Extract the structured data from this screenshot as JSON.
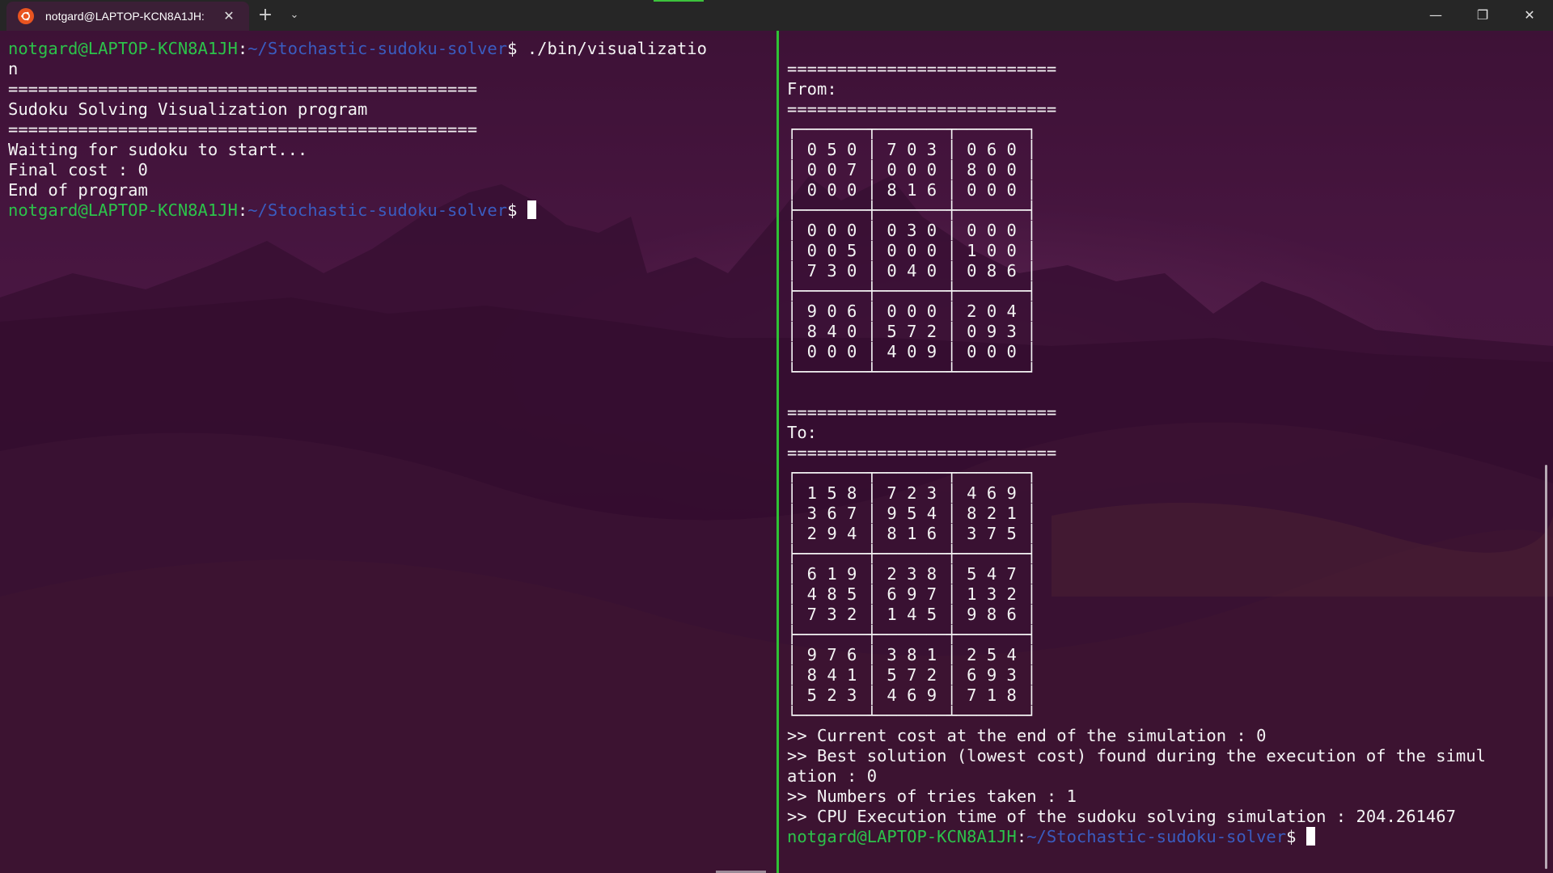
{
  "titlebar": {
    "tab_title": "notgard@LAPTOP-KCN8A1JH:",
    "tab_close_icon": "close-icon",
    "new_tab_glyph": "+",
    "dropdown_glyph": "⌄",
    "minimize_glyph": "—",
    "restore_glyph": "❐",
    "close_glyph": "✕"
  },
  "prompt": {
    "user": "notgard@LAPTOP-KCN8A1JH",
    "colon": ":",
    "path": "~/Stochastic-sudoku-solver",
    "dollar": "$ "
  },
  "left_pane": {
    "command_line1": "./bin/visualizatio",
    "command_line2": "n",
    "lines": [
      "===============================================",
      "Sudoku Solving Visualization program",
      "===============================================",
      "Waiting for sudoku to start...",
      "Final cost : 0",
      "End of program"
    ]
  },
  "right_pane": {
    "from_lines": [
      "===========================",
      "From:",
      "===========================",
      "┌───────┬───────┬───────┐",
      "│ 0 5 0 │ 7 0 3 │ 0 6 0 │",
      "│ 0 0 7 │ 0 0 0 │ 8 0 0 │",
      "│ 0 0 0 │ 8 1 6 │ 0 0 0 │",
      "├───────┼───────┼───────┤",
      "│ 0 0 0 │ 0 3 0 │ 0 0 0 │",
      "│ 0 0 5 │ 0 0 0 │ 1 0 0 │",
      "│ 7 3 0 │ 0 4 0 │ 0 8 6 │",
      "├───────┼───────┼───────┤",
      "│ 9 0 6 │ 0 0 0 │ 2 0 4 │",
      "│ 8 4 0 │ 5 7 2 │ 0 9 3 │",
      "│ 0 0 0 │ 4 0 9 │ 0 0 0 │",
      "└───────┴───────┴───────┘",
      ""
    ],
    "to_lines": [
      "===========================",
      "To:",
      "===========================",
      "┌───────┬───────┬───────┐",
      "│ 1 5 8 │ 7 2 3 │ 4 6 9 │",
      "│ 3 6 7 │ 9 5 4 │ 8 2 1 │",
      "│ 2 9 4 │ 8 1 6 │ 3 7 5 │",
      "├───────┼───────┼───────┤",
      "│ 6 1 9 │ 2 3 8 │ 5 4 7 │",
      "│ 4 8 5 │ 6 9 7 │ 1 3 2 │",
      "│ 7 3 2 │ 1 4 5 │ 9 8 6 │",
      "├───────┼───────┼───────┤",
      "│ 9 7 6 │ 3 8 1 │ 2 5 4 │",
      "│ 8 4 1 │ 5 7 2 │ 6 9 3 │",
      "│ 5 2 3 │ 4 6 9 │ 7 1 8 │",
      "└───────┴───────┴───────┘"
    ],
    "result_lines": [
      ">> Current cost at the end of the simulation : 0",
      ">> Best solution (lowest cost) found during the execution of the simul",
      "ation : 0",
      ">> Numbers of tries taken : 1",
      ">> CPU Execution time of the sudoku solving simulation : 204.261467"
    ]
  },
  "colors": {
    "prompt_user": "#2cc34a",
    "prompt_path": "#3a5cc0",
    "divider": "#2fc235",
    "text": "#f4f4f4"
  }
}
